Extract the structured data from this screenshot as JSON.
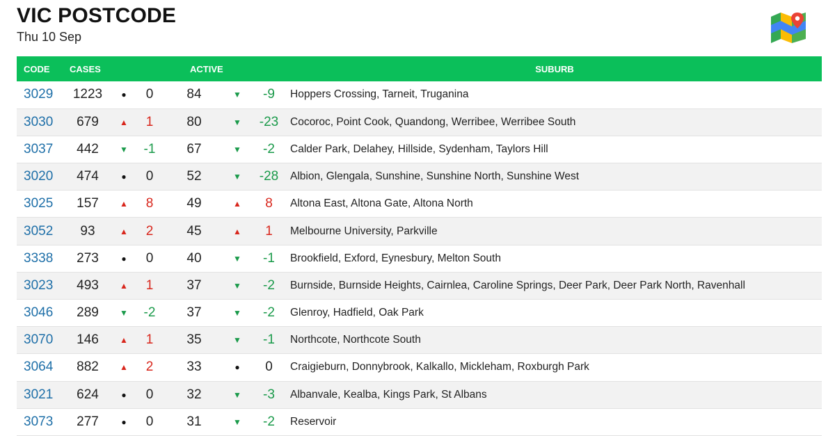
{
  "header": {
    "title": "VIC POSTCODE",
    "date": "Thu 10 Sep"
  },
  "colors": {
    "header_green": "#0bbf5a",
    "up": "#d8261c",
    "down": "#1a9a4a",
    "code": "#1e6fa8"
  },
  "icon": "map-pin-icon",
  "columns": {
    "code": "CODE",
    "cases": "CASES",
    "active": "ACTIVE",
    "suburb": "SUBURB"
  },
  "rows": [
    {
      "code": "3029",
      "cases": "1223",
      "cases_trend": "flat",
      "cases_change": "0",
      "active": "84",
      "active_trend": "down",
      "active_change": "-9",
      "suburb": "Hoppers Crossing, Tarneit, Truganina"
    },
    {
      "code": "3030",
      "cases": "679",
      "cases_trend": "up",
      "cases_change": "1",
      "active": "80",
      "active_trend": "down",
      "active_change": "-23",
      "suburb": "Cocoroc, Point Cook, Quandong, Werribee, Werribee South"
    },
    {
      "code": "3037",
      "cases": "442",
      "cases_trend": "down",
      "cases_change": "-1",
      "active": "67",
      "active_trend": "down",
      "active_change": "-2",
      "suburb": "Calder Park, Delahey, Hillside, Sydenham, Taylors Hill"
    },
    {
      "code": "3020",
      "cases": "474",
      "cases_trend": "flat",
      "cases_change": "0",
      "active": "52",
      "active_trend": "down",
      "active_change": "-28",
      "suburb": "Albion, Glengala, Sunshine, Sunshine North, Sunshine West"
    },
    {
      "code": "3025",
      "cases": "157",
      "cases_trend": "up",
      "cases_change": "8",
      "active": "49",
      "active_trend": "up",
      "active_change": "8",
      "suburb": "Altona East, Altona Gate, Altona North"
    },
    {
      "code": "3052",
      "cases": "93",
      "cases_trend": "up",
      "cases_change": "2",
      "active": "45",
      "active_trend": "up",
      "active_change": "1",
      "suburb": "Melbourne University, Parkville"
    },
    {
      "code": "3338",
      "cases": "273",
      "cases_trend": "flat",
      "cases_change": "0",
      "active": "40",
      "active_trend": "down",
      "active_change": "-1",
      "suburb": "Brookfield, Exford, Eynesbury, Melton South"
    },
    {
      "code": "3023",
      "cases": "493",
      "cases_trend": "up",
      "cases_change": "1",
      "active": "37",
      "active_trend": "down",
      "active_change": "-2",
      "suburb": "Burnside, Burnside Heights, Cairnlea, Caroline Springs, Deer Park, Deer Park North, Ravenhall"
    },
    {
      "code": "3046",
      "cases": "289",
      "cases_trend": "down",
      "cases_change": "-2",
      "active": "37",
      "active_trend": "down",
      "active_change": "-2",
      "suburb": "Glenroy, Hadfield, Oak Park"
    },
    {
      "code": "3070",
      "cases": "146",
      "cases_trend": "up",
      "cases_change": "1",
      "active": "35",
      "active_trend": "down",
      "active_change": "-1",
      "suburb": "Northcote, Northcote South"
    },
    {
      "code": "3064",
      "cases": "882",
      "cases_trend": "up",
      "cases_change": "2",
      "active": "33",
      "active_trend": "flat",
      "active_change": "0",
      "suburb": "Craigieburn, Donnybrook, Kalkallo, Mickleham, Roxburgh Park"
    },
    {
      "code": "3021",
      "cases": "624",
      "cases_trend": "flat",
      "cases_change": "0",
      "active": "32",
      "active_trend": "down",
      "active_change": "-3",
      "suburb": "Albanvale, Kealba, Kings Park, St Albans"
    },
    {
      "code": "3073",
      "cases": "277",
      "cases_trend": "flat",
      "cases_change": "0",
      "active": "31",
      "active_trend": "down",
      "active_change": "-2",
      "suburb": "Reservoir"
    }
  ]
}
